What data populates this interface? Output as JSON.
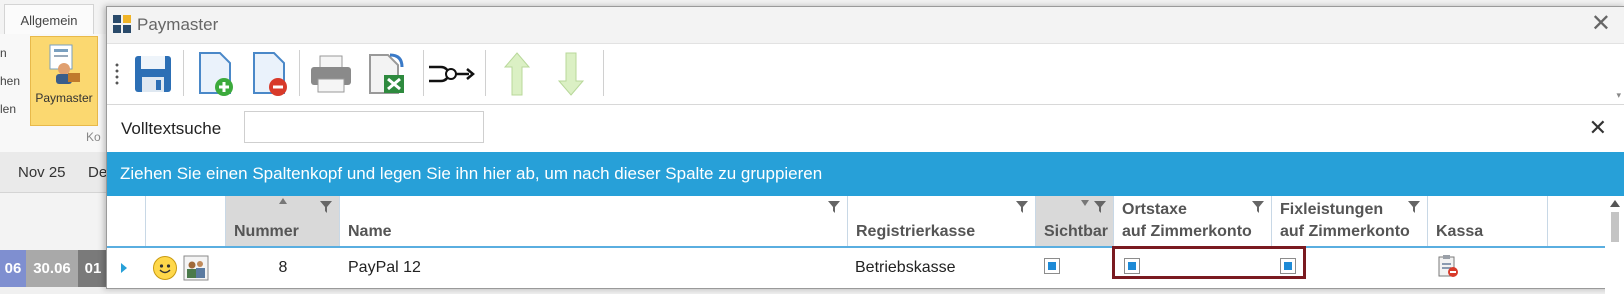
{
  "background_app": {
    "tab_label": "Allgemein",
    "side_labels": [
      "n",
      "hen",
      "len"
    ],
    "ribbon_button": "Paymaster",
    "group_label": "Ko",
    "dates": [
      "Nov 25",
      "De"
    ],
    "cells": [
      "06",
      "30.06",
      "01"
    ]
  },
  "window": {
    "title": "Paymaster"
  },
  "toolbar": {
    "buttons": [
      "save-icon",
      "add-document-icon",
      "remove-document-icon",
      "print-icon",
      "excel-export-icon",
      "merge-icon",
      "move-up-icon",
      "move-down-icon"
    ]
  },
  "search": {
    "label": "Volltextsuche",
    "value": ""
  },
  "group_panel": {
    "text": "Ziehen Sie einen Spaltenkopf und legen Sie ihn hier ab, um nach dieser Spalte zu gruppieren"
  },
  "grid": {
    "columns": [
      {
        "label": ""
      },
      {
        "label": "Nummer"
      },
      {
        "label": "Name"
      },
      {
        "label": "Registrierkasse"
      },
      {
        "label": "Sichtbar"
      },
      {
        "label1": "Ortstaxe",
        "label2": "auf Zimmerkonto"
      },
      {
        "label1": "Fixleistungen",
        "label2": "auf Zimmerkonto"
      },
      {
        "label": "Kassa"
      }
    ],
    "rows": [
      {
        "nummer": "8",
        "name": "PayPal 12",
        "registrierkasse": "Betriebskasse",
        "sichtbar": true,
        "ortstaxe": true,
        "fixleistungen": true
      }
    ]
  },
  "colors": {
    "accent": "#27a0d8",
    "highlight": "#7a1a20",
    "check": "#1e8ad6"
  }
}
